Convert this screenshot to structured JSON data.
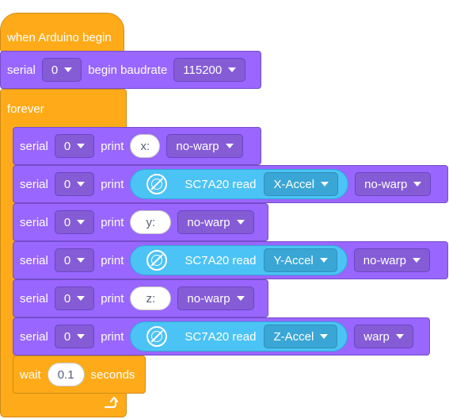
{
  "hat": {
    "label": "when Arduino begin"
  },
  "serial_begin": {
    "serial_label": "serial",
    "port": "0",
    "text": "begin baudrate",
    "baudrate": "115200"
  },
  "forever": {
    "label": "forever"
  },
  "prints": [
    {
      "serial_label": "serial",
      "port": "0",
      "print_label": "print",
      "kind": "text",
      "value": "x:",
      "mode": "no-warp"
    },
    {
      "serial_label": "serial",
      "port": "0",
      "print_label": "print",
      "kind": "sensor",
      "sensor_label": "SC7A20 read",
      "axis": "X-Accel",
      "mode": "no-warp"
    },
    {
      "serial_label": "serial",
      "port": "0",
      "print_label": "print",
      "kind": "text",
      "value": "y:",
      "mode": "no-warp"
    },
    {
      "serial_label": "serial",
      "port": "0",
      "print_label": "print",
      "kind": "sensor",
      "sensor_label": "SC7A20 read",
      "axis": "Y-Accel",
      "mode": "no-warp"
    },
    {
      "serial_label": "serial",
      "port": "0",
      "print_label": "print",
      "kind": "text",
      "value": "z:",
      "mode": "no-warp"
    },
    {
      "serial_label": "serial",
      "port": "0",
      "print_label": "print",
      "kind": "sensor",
      "sensor_label": "SC7A20 read",
      "axis": "Z-Accel",
      "mode": "warp"
    }
  ],
  "wait": {
    "label": "wait",
    "value": "0.1",
    "unit": "seconds"
  },
  "colors": {
    "event": "#ffab19",
    "serial": "#9966ff",
    "sensor": "#4cc3f5"
  },
  "icons": {
    "sensor": "accelerometer-icon",
    "loop": "loop-arrow-icon",
    "dropdown": "caret-down-icon"
  }
}
